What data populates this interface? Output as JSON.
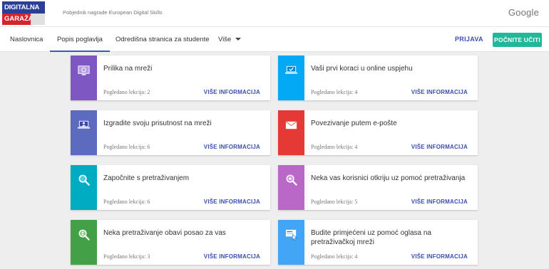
{
  "header": {
    "logo_top": "DIGITALNA",
    "logo_bottom": "GARAŽA",
    "tagline": "Pobjednik nagrade European Digital Skills",
    "brand": "Google"
  },
  "nav": {
    "items": [
      "Naslovnica",
      "Popis poglavlja",
      "Odredišna stranica za studente",
      "Više"
    ],
    "login": "PRIJAVA",
    "start": "POČNITE UČITI"
  },
  "cards": [
    {
      "title": "Prilika na mreži",
      "count": "Pogledano lekcija: 2",
      "more": "VIŠE INFORMACIJA",
      "color": "#7e57c2",
      "icon": "globe-screen-icon"
    },
    {
      "title": "Vaši prvi koraci u online uspjehu",
      "count": "Pogledano lekcija: 4",
      "more": "VIŠE INFORMACIJA",
      "color": "#03a9f4",
      "icon": "laptop-check-icon"
    },
    {
      "title": "Izgradite svoju prisutnost na mreži",
      "count": "Pogledano lekcija: 6",
      "more": "VIŠE INFORMACIJA",
      "color": "#5c6bc0",
      "icon": "laptop-user-icon"
    },
    {
      "title": "Povezivanje putem e-pošte",
      "count": "Pogledano lekcija: 4",
      "more": "VIŠE INFORMACIJA",
      "color": "#e53935",
      "icon": "envelope-icon"
    },
    {
      "title": "Započnite s pretraživanjem",
      "count": "Pogledano lekcija: 6",
      "more": "VIŠE INFORMACIJA",
      "color": "#00acc1",
      "icon": "magnifier-icon"
    },
    {
      "title": "Neka vas korisnici otkriju uz pomoć pretraživanja",
      "count": "Pogledano lekcija: 5",
      "more": "VIŠE INFORMACIJA",
      "color": "#ba68c8",
      "icon": "magnifier-plus-icon"
    },
    {
      "title": "Neka pretraživanje obavi posao za vas",
      "count": "Pogledano lekcija: 3",
      "more": "VIŠE INFORMACIJA",
      "color": "#43a047",
      "icon": "magnifier-user-icon"
    },
    {
      "title": "Budite primjećeni uz pomoć oglasa na pretraživačkoj mreži",
      "count": "Pogledano lekcija: 4",
      "more": "VIŠE INFORMACIJA",
      "color": "#42a5f5",
      "icon": "ad-cursor-icon"
    }
  ]
}
